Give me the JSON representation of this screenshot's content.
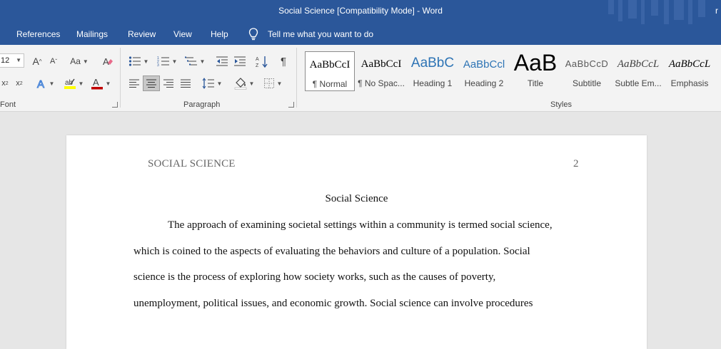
{
  "window": {
    "title": "Social Science [Compatibility Mode]  -  Word",
    "account_initial": "r"
  },
  "menu": {
    "items": [
      "References",
      "Mailings",
      "Review",
      "View",
      "Help"
    ],
    "tell_me": "Tell me what you want to do"
  },
  "ribbon": {
    "font": {
      "size_value": "12",
      "grow_label": "A",
      "shrink_label": "A",
      "case_label": "Aa",
      "subscript_label": "x",
      "superscript_label": "x",
      "group_label": "Font"
    },
    "paragraph": {
      "group_label": "Paragraph"
    },
    "styles": {
      "group_label": "Styles",
      "items": [
        {
          "preview": "AaBbCcI",
          "name": "¶ Normal",
          "selected": true
        },
        {
          "preview": "AaBbCcI",
          "name": "¶ No Spac..."
        },
        {
          "preview": "AaBbC",
          "name": "Heading 1"
        },
        {
          "preview": "AaBbCcl",
          "name": "Heading 2"
        },
        {
          "preview": "AaB",
          "name": "Title"
        },
        {
          "preview": "AaBbCcD",
          "name": "Subtitle"
        },
        {
          "preview": "AaBbCcL",
          "name": "Subtle Em..."
        },
        {
          "preview": "AaBbCcL",
          "name": "Emphasis"
        }
      ]
    }
  },
  "colors": {
    "brand": "#2b579a",
    "highlight": "#ffff00",
    "font_color": "#c00000"
  },
  "document": {
    "header_left": "SOCIAL SCIENCE",
    "header_right": "2",
    "title": "Social Science",
    "lines": [
      "The approach of examining societal settings within a community is termed social science,",
      "which is coined to the aspects of evaluating the behaviors and culture of a population. Social",
      "science is the process of exploring how society works, such as the causes of poverty,",
      "unemployment, political issues, and economic growth. Social science can involve procedures"
    ]
  }
}
